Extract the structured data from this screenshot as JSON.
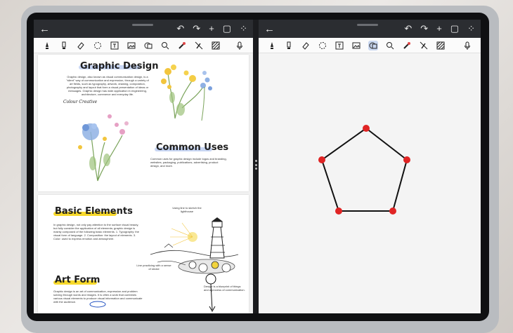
{
  "window": {
    "left_pane": {
      "top_actions": [
        "↶",
        "↷",
        "+",
        "▢",
        "⁘"
      ]
    },
    "right_pane": {
      "top_actions": [
        "↶",
        "↷",
        "+",
        "▢",
        "⁘"
      ],
      "shape": "pentagon"
    }
  },
  "document": {
    "graphic_design_title": "Graphic Design",
    "graphic_design_body": "Graphic design, also known as visual communication design, is a \"silent\" way of communication and expression, through a variety of art fields, such as typography, artwork, drawing, composition, photography and layout that form a visual presentation of ideas or messages. Graphic design has wide application in engineering, architecture, commerce and everyday life.",
    "colour_creative_label": "Colour Creative",
    "common_uses_title": "Common Uses",
    "common_uses_body": "Common uses for graphic design include logos and branding, websites, packaging, publications, advertising, product design, and more.",
    "basic_elements_title": "Basic Elements",
    "basic_elements_body": "In graphic design, not only pay attention to the surface visual beauty, but fully consider the application of all elements; graphic design is mainly composed of the following basic elements. 1. Typography: the visual form of language. 2. Composition: the layout of elements. 3. Color: used to express emotion and atmosphere.",
    "lighthouse_caption": "Using line to sketch the lighthouse",
    "line_caption": "Line practicing with a sense of stroke",
    "art_form_title": "Art Form",
    "art_form_body": "Graphic design is an art of communication, expression and problem solving through words and images. It is often a work that combines various visual elements to produce visual information and communicate with the audience.",
    "design_caption": "Design is a blueprint of things and a process of communication."
  },
  "colors": {
    "accent_highlight_blue": "#c8d6f3",
    "accent_highlight_yellow": "#f7d92b",
    "vertex": "#e02424",
    "edge": "#111111"
  },
  "icons": {
    "toolbar": [
      "pen-icon",
      "highlighter-icon",
      "eraser-icon",
      "lasso-icon",
      "text-icon",
      "image-icon",
      "shape-icon",
      "zoom-icon",
      "laser-pointer-icon",
      "hide-ink-icon",
      "pattern-icon",
      "microphone-icon"
    ]
  }
}
